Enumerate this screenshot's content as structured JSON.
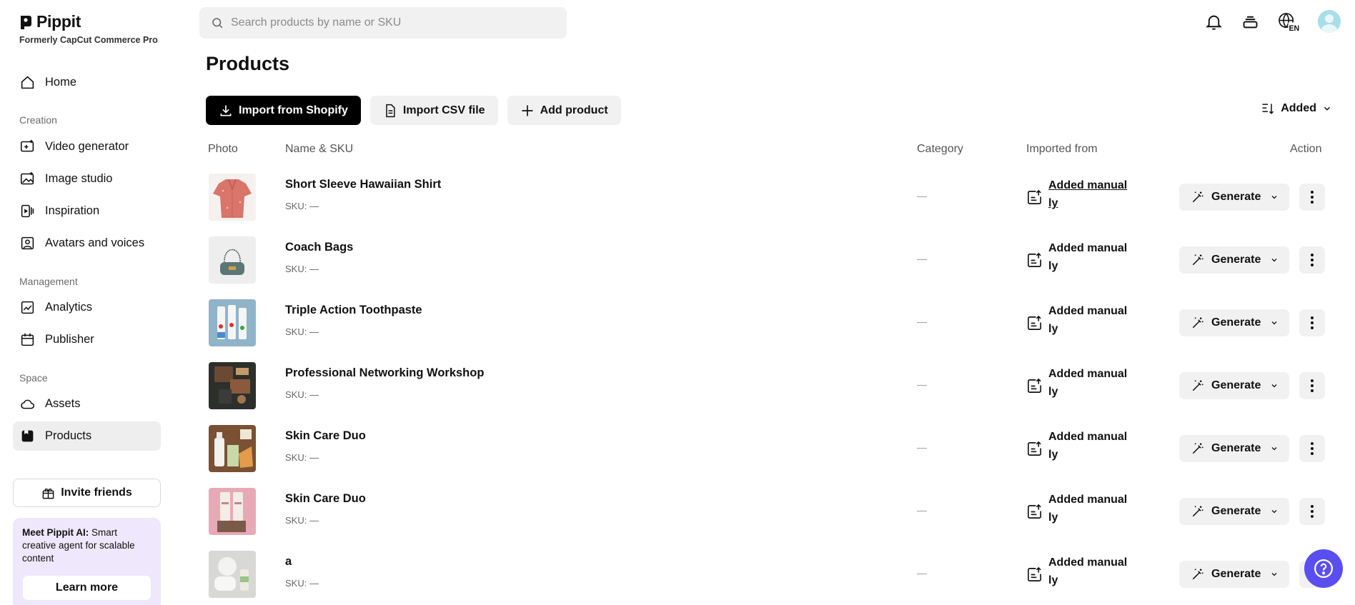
{
  "brand": {
    "name": "Pippit",
    "subtitle": "Formerly CapCut Commerce Pro"
  },
  "sidebar": {
    "home": "Home",
    "sections": {
      "creation": "Creation",
      "management": "Management",
      "space": "Space"
    },
    "creation_items": [
      {
        "label": "Video generator",
        "icon": "video-plus-icon"
      },
      {
        "label": "Image studio",
        "icon": "image-plus-icon"
      },
      {
        "label": "Inspiration",
        "icon": "inspiration-icon"
      },
      {
        "label": "Avatars and voices",
        "icon": "avatar-icon"
      }
    ],
    "management_items": [
      {
        "label": "Analytics",
        "icon": "analytics-icon"
      },
      {
        "label": "Publisher",
        "icon": "calendar-icon"
      }
    ],
    "space_items": [
      {
        "label": "Assets",
        "icon": "cloud-icon"
      },
      {
        "label": "Products",
        "icon": "products-icon",
        "active": true
      }
    ],
    "invite": "Invite friends",
    "promo": {
      "bold": "Meet Pippit AI:",
      "text": " Smart creative agent for scalable content",
      "button": "Learn more"
    }
  },
  "search": {
    "placeholder": "Search products by name or SKU",
    "value": ""
  },
  "top_icons": [
    "bell-icon",
    "stack-icon",
    "language-icon",
    "avatar"
  ],
  "language": "EN",
  "page": {
    "title": "Products",
    "import_shopify": "Import from Shopify",
    "import_csv": "Import CSV file",
    "add_product": "Add product",
    "sort_label": "Added"
  },
  "table": {
    "columns": {
      "photo": "Photo",
      "name": "Name & SKU",
      "category": "Category",
      "imported": "Imported from",
      "action": "Action"
    },
    "rows": [
      {
        "name": "Short Sleeve Hawaiian Shirt",
        "sku": "SKU: —",
        "category": "—",
        "imported": "Added manually",
        "action": "Generate",
        "thumb": "shirt"
      },
      {
        "name": "Coach Bags",
        "sku": "SKU: —",
        "category": "—",
        "imported": "Added manually",
        "action": "Generate",
        "thumb": "bag"
      },
      {
        "name": "Triple Action Toothpaste",
        "sku": "SKU: —",
        "category": "—",
        "imported": "Added manually",
        "action": "Generate",
        "thumb": "toothpaste"
      },
      {
        "name": "Professional Networking Workshop",
        "sku": "SKU: —",
        "category": "—",
        "imported": "Added manually",
        "action": "Generate",
        "thumb": "workshop"
      },
      {
        "name": "Skin Care Duo",
        "sku": "SKU: —",
        "category": "—",
        "imported": "Added manually",
        "action": "Generate",
        "thumb": "skincare1"
      },
      {
        "name": "Skin Care Duo",
        "sku": "SKU: —",
        "category": "—",
        "imported": "Added manually",
        "action": "Generate",
        "thumb": "skincare2"
      },
      {
        "name": "a",
        "sku": "SKU: —",
        "category": "—",
        "imported": "Added manually",
        "action": "Generate",
        "thumb": "misc"
      }
    ]
  },
  "colors": {
    "accent": "#5b4ef0",
    "promo_bg": "#efe7fb",
    "button_bg": "#f1f1f2",
    "primary": "#000000"
  }
}
